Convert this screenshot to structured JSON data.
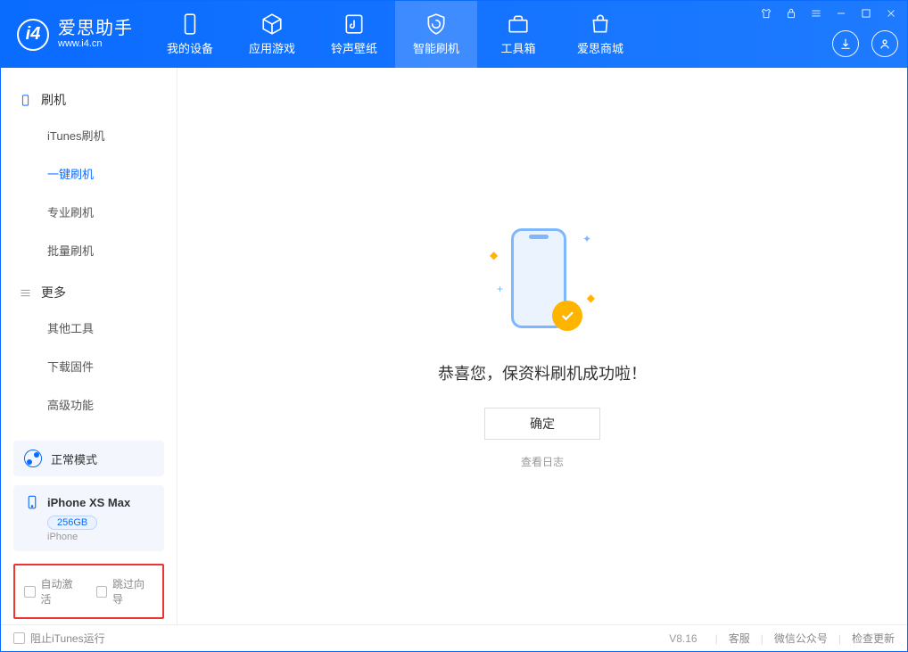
{
  "app": {
    "title": "爱思助手",
    "subtitle": "www.i4.cn"
  },
  "nav": {
    "items": [
      {
        "label": "我的设备"
      },
      {
        "label": "应用游戏"
      },
      {
        "label": "铃声壁纸"
      },
      {
        "label": "智能刷机"
      },
      {
        "label": "工具箱"
      },
      {
        "label": "爱思商城"
      }
    ]
  },
  "sidebar": {
    "section_flash": {
      "title": "刷机"
    },
    "section_more": {
      "title": "更多"
    },
    "items_flash": [
      {
        "label": "iTunes刷机"
      },
      {
        "label": "一键刷机"
      },
      {
        "label": "专业刷机"
      },
      {
        "label": "批量刷机"
      }
    ],
    "items_more": [
      {
        "label": "其他工具"
      },
      {
        "label": "下载固件"
      },
      {
        "label": "高级功能"
      }
    ],
    "mode": {
      "label": "正常模式"
    },
    "device": {
      "name": "iPhone XS Max",
      "storage": "256GB",
      "type": "iPhone"
    },
    "checks": {
      "auto_activate": "自动激活",
      "skip_guide": "跳过向导"
    }
  },
  "main": {
    "success_title": "恭喜您，保资料刷机成功啦！",
    "ok_label": "确定",
    "log_label": "查看日志"
  },
  "statusbar": {
    "block_itunes": "阻止iTunes运行",
    "version": "V8.16",
    "support": "客服",
    "wechat": "微信公众号",
    "update": "检查更新"
  }
}
